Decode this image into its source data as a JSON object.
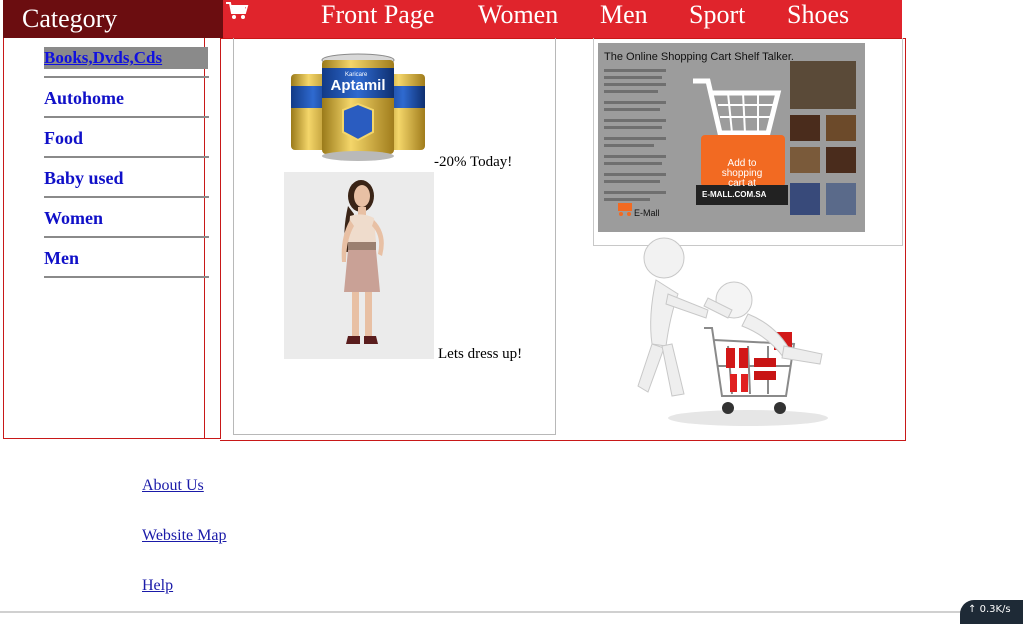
{
  "category_header": {
    "title": "Category"
  },
  "nav": {
    "cart_icon": "shopping-cart-icon",
    "items": [
      {
        "label": "Front Page"
      },
      {
        "label": "Women"
      },
      {
        "label": "Men"
      },
      {
        "label": "Sport"
      },
      {
        "label": "Shoes"
      }
    ]
  },
  "sidebar": {
    "items": [
      {
        "label": "Books,Dvds,Cds",
        "active": true
      },
      {
        "label": "Autohome"
      },
      {
        "label": "Food"
      },
      {
        "label": "Baby used"
      },
      {
        "label": "Women"
      },
      {
        "label": "Men"
      }
    ]
  },
  "promos": {
    "milk_caption": "-20% Today!",
    "milk_brand": "Aptamil",
    "milk_maker": "Karicare",
    "dress_caption": "Lets dress up!"
  },
  "poster": {
    "title": "The Online Shopping Cart Shelf Talker.",
    "cta": "Add to shopping cart at",
    "site": "E-MALL.COM.SA",
    "logo": "E-Mall"
  },
  "footer": {
    "links": [
      {
        "label": "About Us"
      },
      {
        "label": "Website Map"
      },
      {
        "label": "Help"
      }
    ]
  },
  "widget": {
    "speed": "0.3K/s"
  },
  "colors": {
    "header_dark": "#6b0d10",
    "nav_red": "#e0242c",
    "link_blue": "#1010c8",
    "border_red": "#c81818"
  }
}
